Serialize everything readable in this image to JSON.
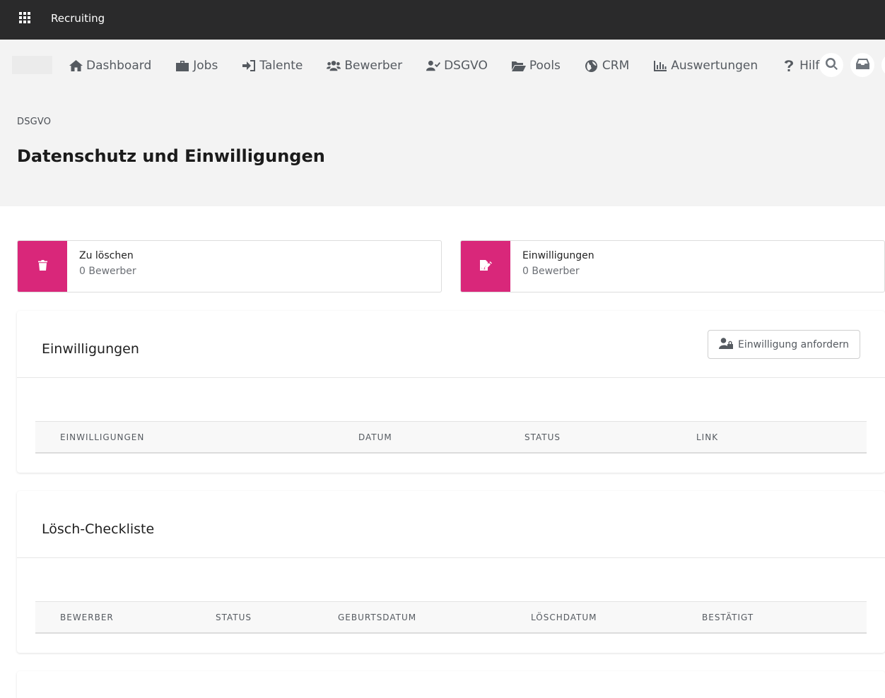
{
  "app": {
    "title": "Recruiting"
  },
  "nav": {
    "items": [
      {
        "label": "Dashboard",
        "icon": "home-icon"
      },
      {
        "label": "Jobs",
        "icon": "briefcase-icon"
      },
      {
        "label": "Talente",
        "icon": "sign-in-icon"
      },
      {
        "label": "Bewerber",
        "icon": "users-icon"
      },
      {
        "label": "DSGVO",
        "icon": "user-check-icon"
      },
      {
        "label": "Pools",
        "icon": "folder-open-icon"
      },
      {
        "label": "CRM",
        "icon": "globe-icon"
      },
      {
        "label": "Auswertungen",
        "icon": "bar-chart-icon"
      },
      {
        "label": "Hilfe",
        "icon": "question-icon"
      }
    ]
  },
  "page": {
    "breadcrumb": "DSGVO",
    "title": "Datenschutz und Einwilligungen"
  },
  "stats": [
    {
      "label": "Zu löschen",
      "value": "0 Bewerber",
      "icon": "trash-icon"
    },
    {
      "label": "Einwilligungen",
      "value": "0 Bewerber",
      "icon": "file-signature-icon"
    }
  ],
  "consents_panel": {
    "title": "Einwilligungen",
    "request_button": "Einwilligung anfordern",
    "columns": [
      "Einwilligungen",
      "Datum",
      "Status",
      "Link"
    ]
  },
  "deletion_panel": {
    "title": "Lösch-Checkliste",
    "columns": [
      "Bewerber",
      "Status",
      "Geburtsdatum",
      "Löschdatum",
      "Bestätigt"
    ]
  },
  "colors": {
    "topbar": "#2a2a2b",
    "accent": "#d9277a",
    "header_bg": "#f3f3f3"
  }
}
